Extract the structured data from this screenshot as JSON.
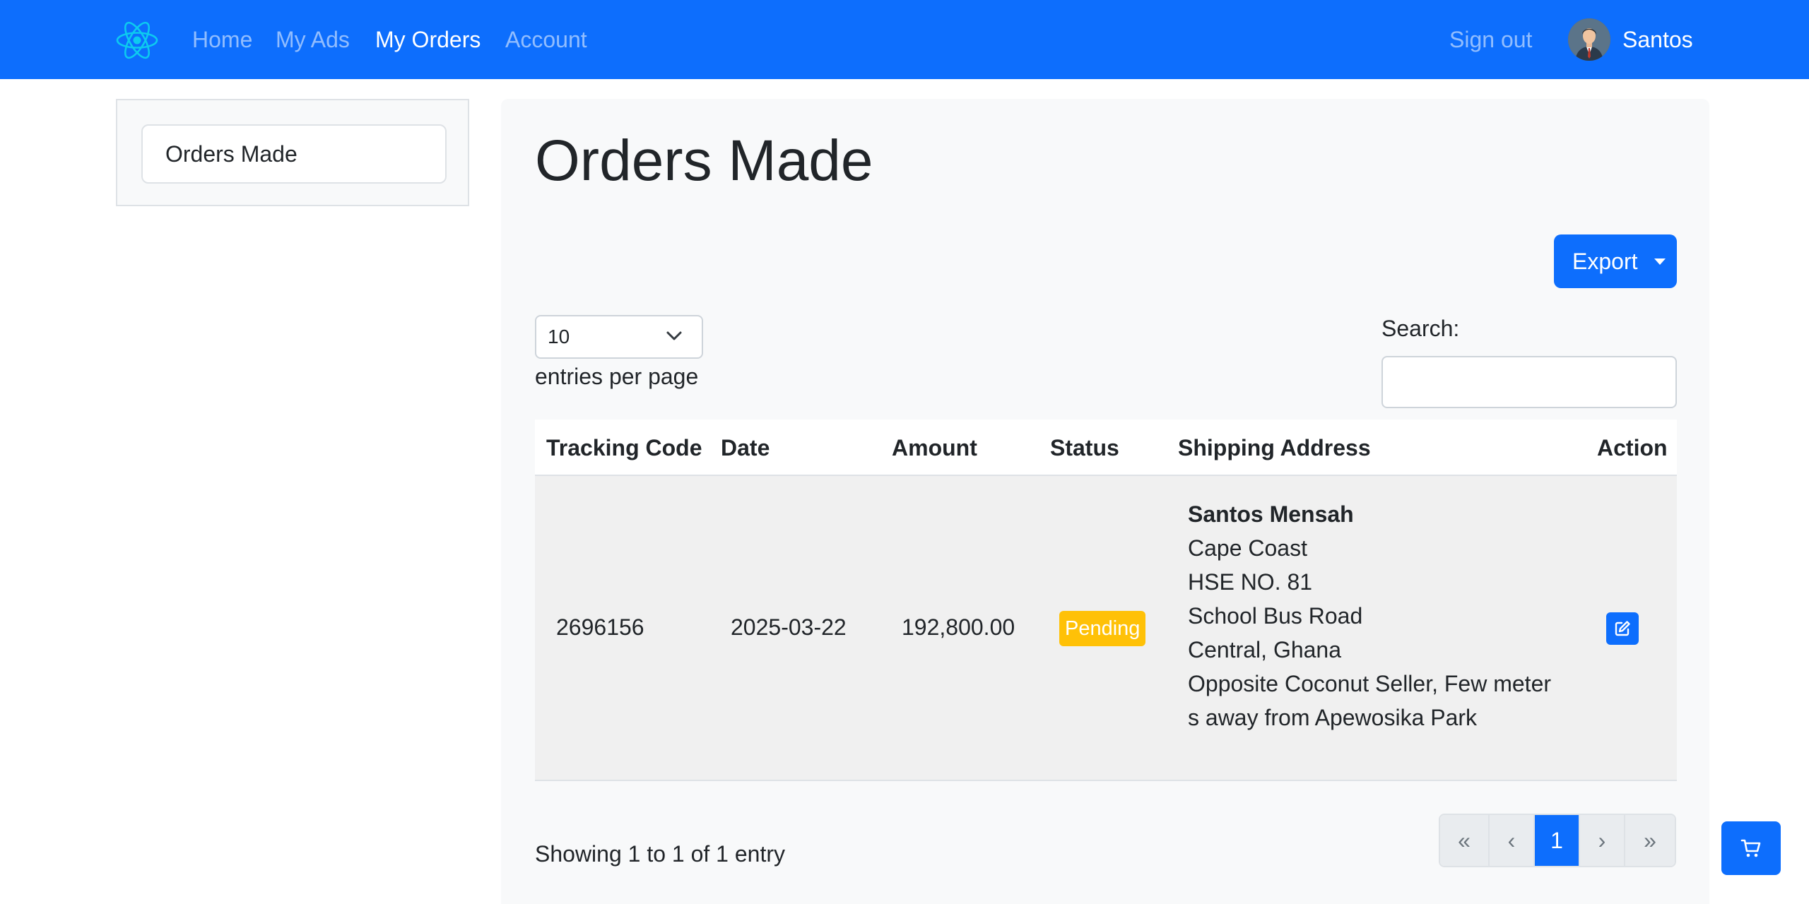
{
  "navbar": {
    "brand_icon": "react-atom-icon",
    "links": [
      "Home",
      "My Ads",
      "My Orders",
      "Account"
    ],
    "active_link": "My Orders",
    "sign_out": "Sign out",
    "user_name": "Santos",
    "colors": {
      "bar": "#0d6efd",
      "brand": "#0dcaf0"
    }
  },
  "sidebar": {
    "items": [
      {
        "label": "Orders Made"
      }
    ]
  },
  "main": {
    "title": "Orders Made",
    "export_label": "Export",
    "per_page": {
      "value": "10",
      "label": "entries per page"
    },
    "search": {
      "label": "Search:",
      "value": ""
    },
    "table": {
      "columns": [
        "Tracking Code",
        "Date",
        "Amount",
        "Status",
        "Shipping Address",
        "Action"
      ],
      "rows": [
        {
          "tracking_code": "2696156",
          "date": "2025-03-22",
          "amount": "192,800.00",
          "status": "Pending",
          "status_color": "#ffc107",
          "address": {
            "name": "Santos Mensah",
            "lines": [
              "Cape Coast",
              "HSE NO. 81",
              "School Bus Road",
              "Central, Ghana",
              "Opposite Coconut Seller, Few meter",
              "s away from Apewosika Park"
            ]
          },
          "action_icon": "edit-icon"
        }
      ]
    },
    "showing": "Showing 1 to 1 of 1 entry",
    "pagination": [
      "«",
      "‹",
      "1",
      "›",
      "»"
    ],
    "current_page": "1"
  },
  "cart_icon": "cart-icon"
}
